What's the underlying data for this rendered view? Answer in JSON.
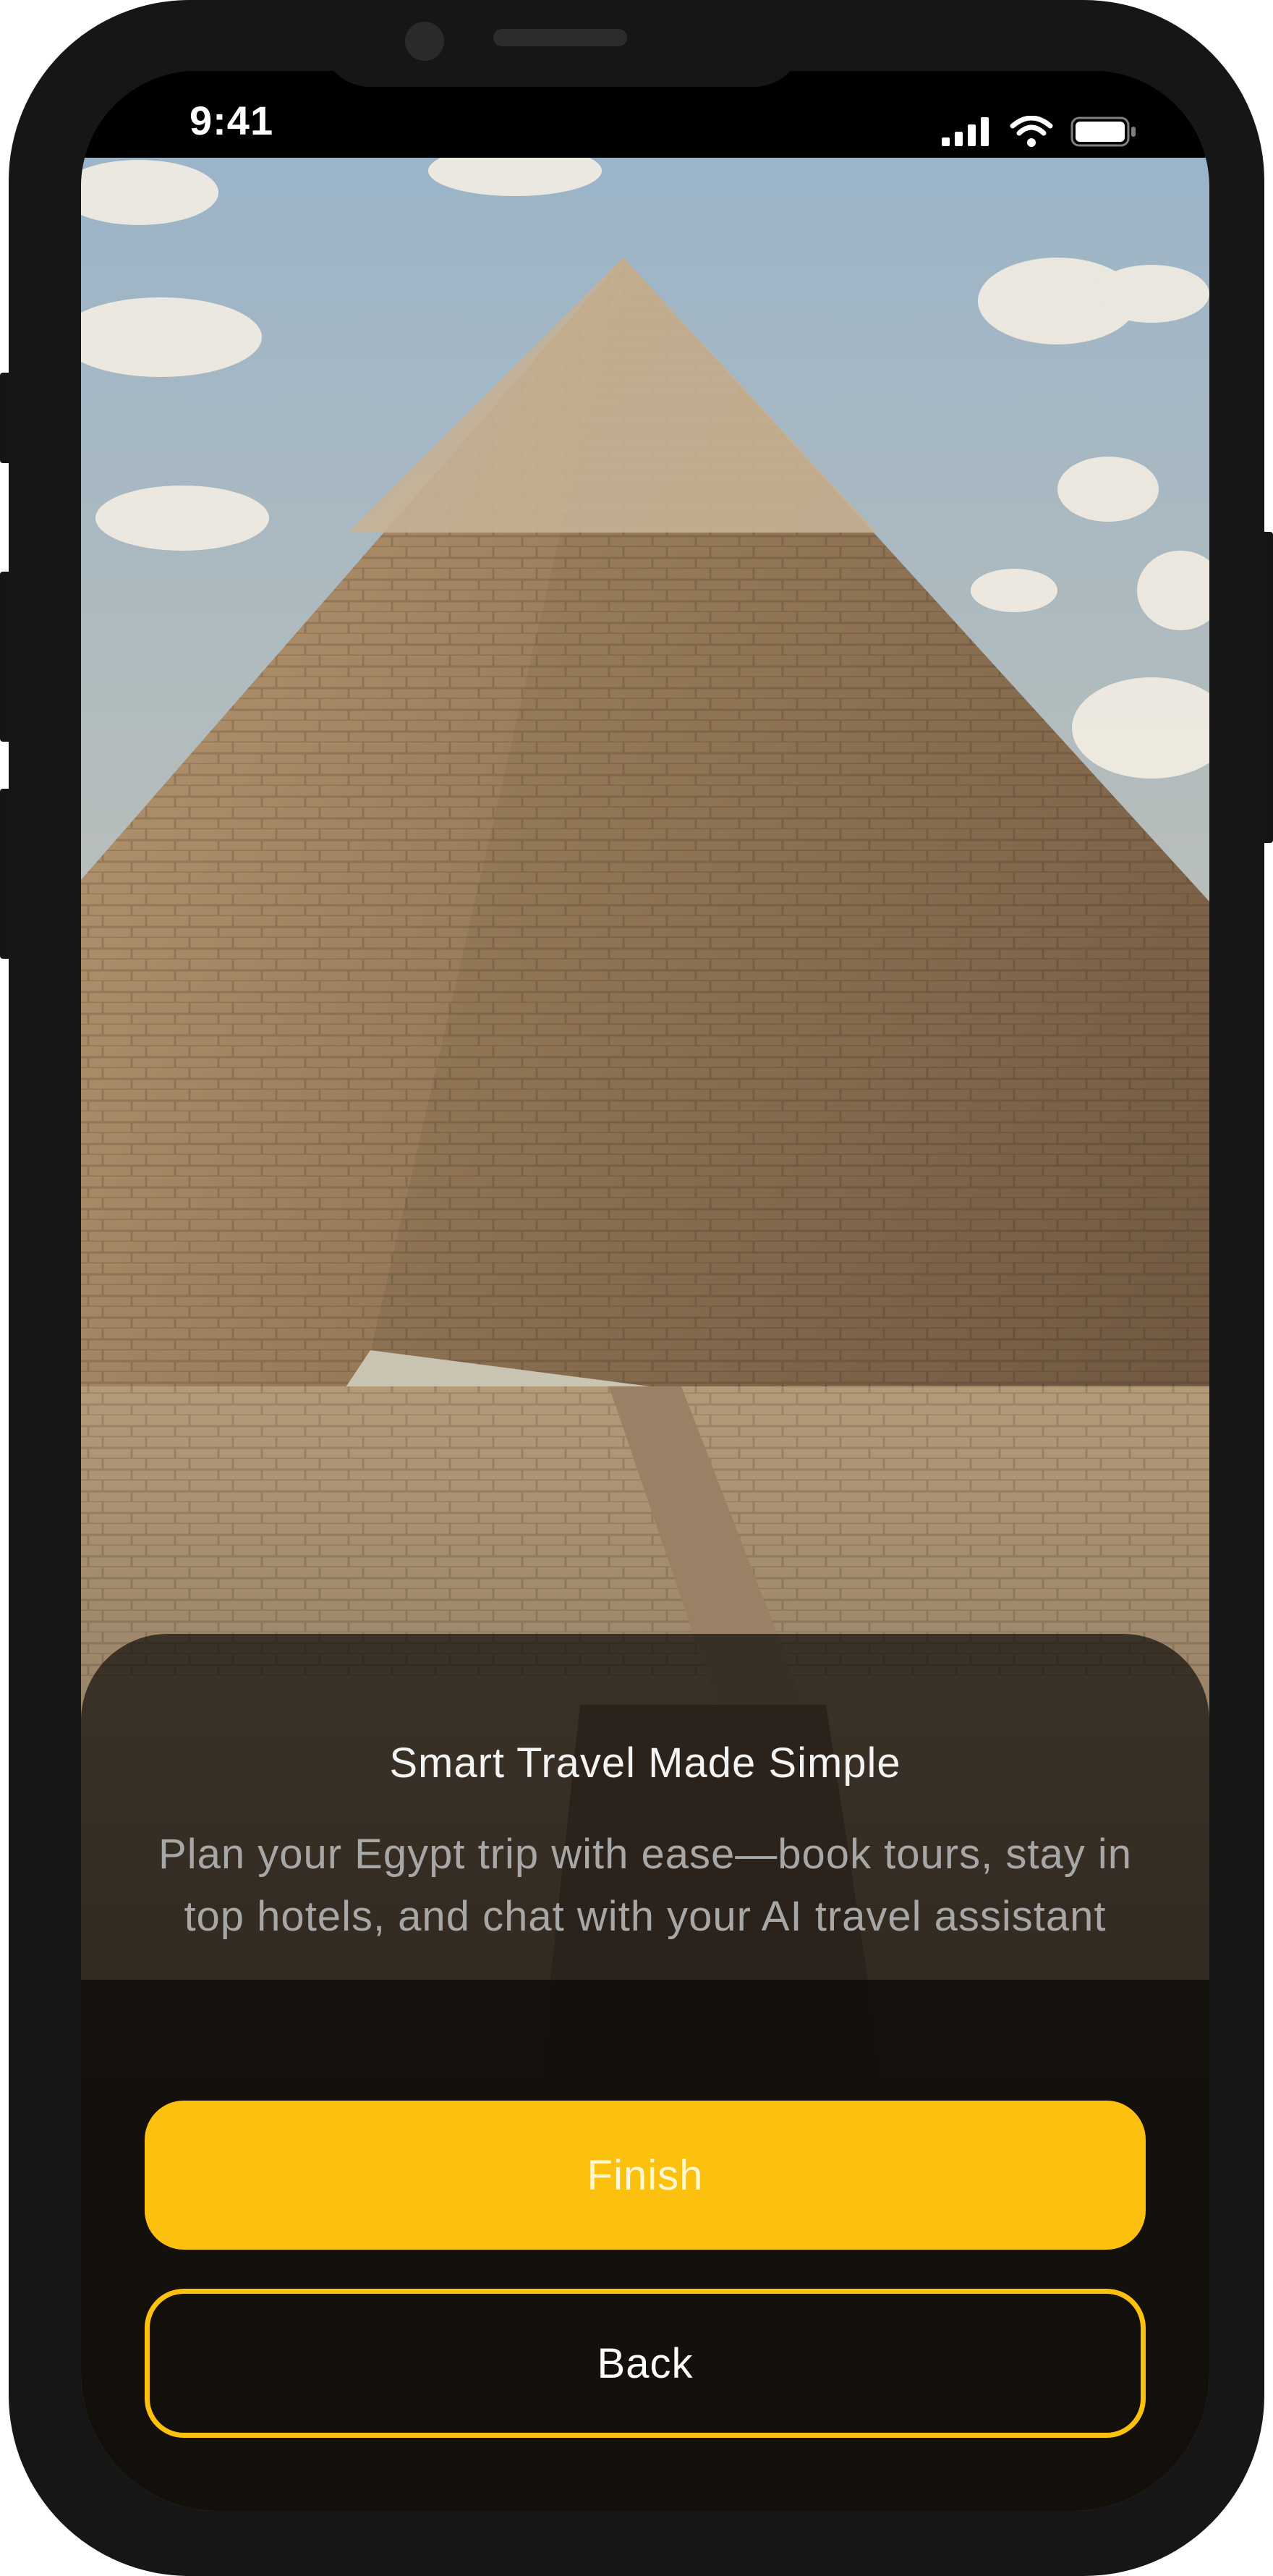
{
  "status_bar": {
    "time": "9:41",
    "icons": [
      "cellular-signal-icon",
      "wifi-icon",
      "battery-icon"
    ]
  },
  "hero": {
    "image": "great-pyramid-with-crowd-photo"
  },
  "onboarding": {
    "title": "Smart Travel Made Simple",
    "description": "Plan your Egypt trip with ease—book tours, stay in top hotels, and chat with your AI travel assistant",
    "finish_label": "Finish",
    "back_label": "Back"
  },
  "colors": {
    "accent": "#fcc10f",
    "frame": "#161616",
    "sheet": "#0c0a08"
  }
}
